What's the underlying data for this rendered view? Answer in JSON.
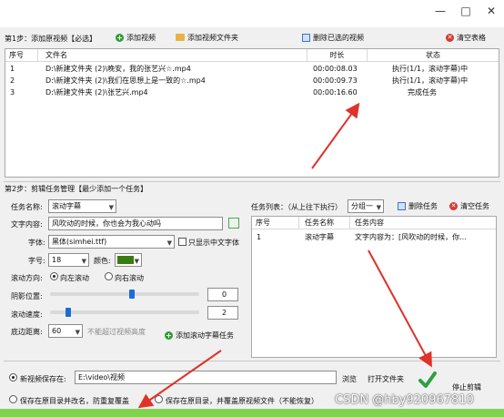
{
  "window": {
    "minimize": "—",
    "maximize": "□",
    "close": "✕"
  },
  "step1": {
    "title": "第1步：添加原视频【必选】",
    "add_video": "添加视频",
    "add_folder": "添加视频文件夹",
    "delete_selected": "删除已选的视频",
    "clear_table": "清空表格"
  },
  "file_table": {
    "headers": [
      "序号",
      "文件名",
      "时长",
      "状态"
    ],
    "rows": [
      {
        "no": "1",
        "name": "D:\\新建文件夹 (2)\\晚安，我的张艺兴☆.mp4",
        "duration": "00:00:08.03",
        "status": "执行(1/1，滚动字幕)中"
      },
      {
        "no": "2",
        "name": "D:\\新建文件夹 (2)\\我们在思想上是一致的☆.mp4",
        "duration": "00:00:09.73",
        "status": "执行(1/1，滚动字幕)中"
      },
      {
        "no": "3",
        "name": "D:\\新建文件夹 (2)\\张艺兴.mp4",
        "duration": "00:00:16.60",
        "status": "完成任务"
      }
    ]
  },
  "step2": {
    "title": "第2步：剪辑任务管理【最少添加一个任务】",
    "task_name_label": "任务名称:",
    "task_name_value": "滚动字幕",
    "text_label": "文字内容:",
    "text_value": "风吹动的时候，你也会为我心动吗",
    "font_label": "字体:",
    "font_value": "黑体(simhei.ttf)",
    "only_chinese_label": "只显示中文字体",
    "size_label": "字号:",
    "size_value": "18",
    "color_label": "颜色:",
    "color_hex": "#3a7a12",
    "direction_label": "滚动方向:",
    "dir_left": "向左滚动",
    "dir_right": "向右滚动",
    "shadow_label": "阴影位置:",
    "shadow_value": "0",
    "shadow_level": 0.55,
    "speed_label": "滚动速度:",
    "speed_value": "2",
    "speed_level": 0.12,
    "bottom_label": "底边距离:",
    "bottom_value": "60",
    "bottom_hint": "不能超过视频高度",
    "add_task": "添加滚动字幕任务"
  },
  "task_list": {
    "label": "任务列表：（从上往下执行）",
    "group_value": "分组一",
    "delete_task": "删除任务",
    "clear_table": "清空任务",
    "headers": [
      "序号",
      "任务名称",
      "任务内容"
    ],
    "rows": [
      {
        "no": "1",
        "name": "滚动字幕",
        "content": "文字内容为：[风吹动的时候，你..."
      }
    ]
  },
  "save": {
    "new_save_label": "新视频保存在:",
    "path_value": "E:\\video\\视频",
    "browse": "浏览",
    "open_folder": "打开文件夹",
    "option_rename": "保存在原目录并改名，防重复覆盖",
    "option_overwrite": "保存在原目录，并覆盖原视频文件（不能恢复）",
    "stop": "停止剪辑"
  },
  "watermark": "CSDN @hby920967810",
  "colors": {
    "accent_red": "#e0312a",
    "progress_green": "#7fd34f",
    "link_blue": "#1c6bd6"
  }
}
